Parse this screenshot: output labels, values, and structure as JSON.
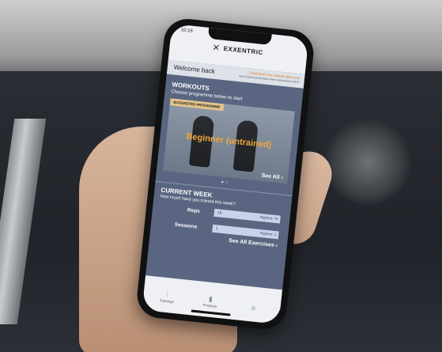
{
  "status_bar": {
    "time": "10:16"
  },
  "app": {
    "brand": "EXXENTRIC",
    "logo_mark": "⨉"
  },
  "header": {
    "welcome": "Welcome back",
    "download": "Download new content files now",
    "download_sub": "Auto Download will start when connected to Wi-Fi"
  },
  "workouts": {
    "title": "WORKOUTS",
    "subtitle": "Choose programme below to start",
    "tag": "SUGGESTED PROGRAMME",
    "programme_title": "Beginner (untrained)",
    "see_all": "See All ›",
    "pager_dots": "● ○"
  },
  "current_week": {
    "title": "CURRENT WEEK",
    "question": "How much have you trained this week?",
    "metrics": [
      {
        "label": "Reps",
        "value": "16",
        "highest": "Highest: 70"
      },
      {
        "label": "Sessions",
        "value": "1",
        "highest": "Highest: 1"
      }
    ],
    "see_all_exercises": "See All Exercises ›"
  },
  "tabs": [
    {
      "label": "Trainings",
      "icon": "dumbbell-icon",
      "glyph": "⫶"
    },
    {
      "label": "Progress",
      "icon": "chart-icon",
      "glyph": "▮"
    },
    {
      "label": "",
      "icon": "menu-icon",
      "glyph": "≡"
    }
  ]
}
